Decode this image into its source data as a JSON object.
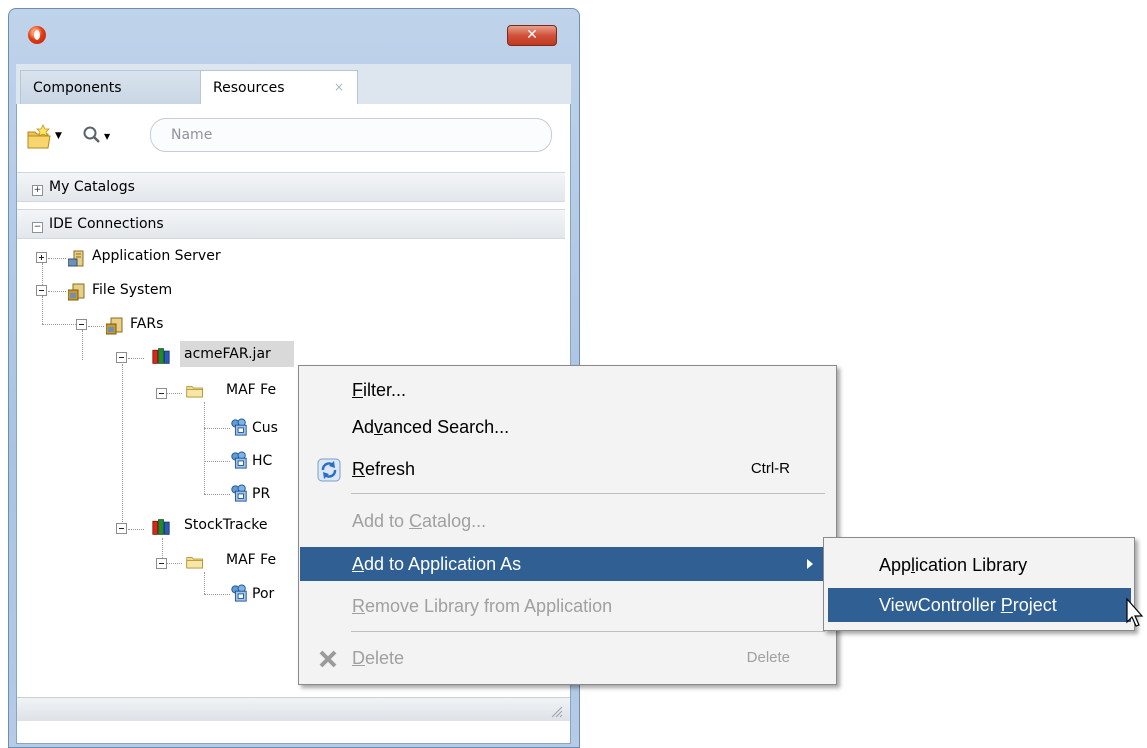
{
  "window": {
    "close_label": "✕"
  },
  "tabs": [
    {
      "label": "Components"
    },
    {
      "label": "Resources",
      "close": "×"
    }
  ],
  "toolbar": {
    "new_dropdown": "▼",
    "search_dropdown": "▼",
    "search_placeholder": "Name"
  },
  "accordions": {
    "catalogs": {
      "sign": "+",
      "label": "My Catalogs"
    },
    "ide": {
      "sign": "−",
      "label": "IDE Connections"
    }
  },
  "tree": {
    "app_server": "Application Server",
    "file_system": "File System",
    "fars": "FARs",
    "acme_far": "acmeFAR.jar",
    "maf_fe_1": "MAF Fe",
    "cus": "Cus",
    "hc": "HC",
    "pr": "PR",
    "stocktracker": "StockTracke",
    "maf_fe_2": "MAF Fe",
    "por": "Por"
  },
  "context_menu": {
    "filter": {
      "pre": "",
      "u": "F",
      "post": "ilter..."
    },
    "advanced_search": {
      "pre": "Ad",
      "u": "v",
      "post": "anced Search..."
    },
    "refresh": {
      "pre": "",
      "u": "R",
      "post": "efresh",
      "shortcut": "Ctrl-R"
    },
    "add_catalog": {
      "pre": "Add to ",
      "u": "C",
      "post": "atalog..."
    },
    "add_application": {
      "pre": "",
      "u": "A",
      "post": "dd to Application As"
    },
    "remove_library": {
      "pre": "",
      "u": "R",
      "post": "emove Library from Application"
    },
    "delete": {
      "pre": "",
      "u": "D",
      "post": "elete",
      "shortcut": "Delete"
    }
  },
  "submenu": {
    "app_library": {
      "pre": "App",
      "u": "l",
      "post": "ication Library"
    },
    "viewcontroller": {
      "pre": "ViewController ",
      "u": "P",
      "post": "roject"
    }
  },
  "colors": {
    "highlight": "#2f5f93",
    "menu_bg": "#f3f3f3",
    "disabled_text": "#a0a0a0"
  }
}
